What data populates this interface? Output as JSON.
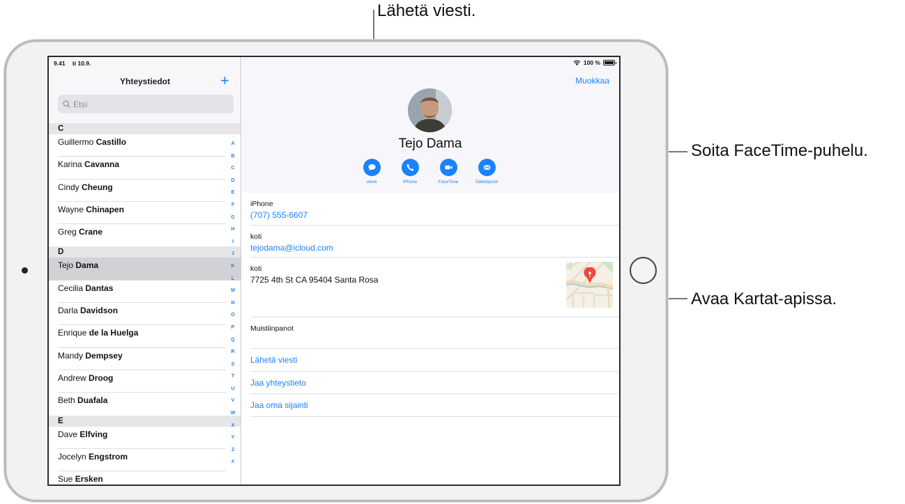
{
  "callouts": {
    "send_message": "Lähetä viesti.",
    "facetime": "Soita FaceTime-puhelu.",
    "maps": "Avaa Kartat-apissa."
  },
  "status_bar": {
    "time": "9.41",
    "date": "ti 10.9.",
    "battery": "100 %"
  },
  "list_pane": {
    "title": "Yhteystiedot",
    "add_label": "+",
    "search_placeholder": "Etsi",
    "sections": [
      {
        "letter": "C",
        "contacts": [
          {
            "first": "Guillermo",
            "last": "Castillo"
          },
          {
            "first": "Karina",
            "last": "Cavanna"
          },
          {
            "first": "Cindy",
            "last": "Cheung"
          },
          {
            "first": "Wayne",
            "last": "Chinapen"
          },
          {
            "first": "Greg",
            "last": "Crane"
          }
        ]
      },
      {
        "letter": "D",
        "contacts": [
          {
            "first": "Tejo",
            "last": "Dama",
            "selected": true
          },
          {
            "first": "Cecilia",
            "last": "Dantas"
          },
          {
            "first": "Darla",
            "last": "Davidson"
          },
          {
            "first": "Enrique",
            "last": "de la Huelga"
          },
          {
            "first": "Mandy",
            "last": "Dempsey"
          },
          {
            "first": "Andrew",
            "last": "Droog"
          },
          {
            "first": "Beth",
            "last": "Duafala"
          }
        ]
      },
      {
        "letter": "E",
        "contacts": [
          {
            "first": "Dave",
            "last": "Elfving"
          },
          {
            "first": "Jocelyn",
            "last": "Engstrom"
          },
          {
            "first": "Sue",
            "last": "Ersken"
          }
        ]
      }
    ],
    "index": [
      "A",
      "B",
      "C",
      "D",
      "E",
      "F",
      "G",
      "H",
      "I",
      "J",
      "K",
      "L",
      "M",
      "N",
      "O",
      "P",
      "Q",
      "R",
      "S",
      "T",
      "U",
      "V",
      "W",
      "X",
      "Y",
      "Z",
      "#"
    ]
  },
  "detail": {
    "edit_label": "Muokkaa",
    "name": "Tejo Dama",
    "actions": [
      {
        "label": "viesti",
        "icon": "message-icon"
      },
      {
        "label": "iPhone",
        "icon": "phone-icon"
      },
      {
        "label": "FaceTime",
        "icon": "video-icon"
      },
      {
        "label": "Sähköposti",
        "icon": "mail-icon"
      }
    ],
    "phone": {
      "label": "iPhone",
      "value": "(707) 555-6607"
    },
    "email": {
      "label": "koti",
      "value": "tejodama@icloud.com"
    },
    "address": {
      "label": "koti",
      "value": "7725 4th St CA 95404 Santa Rosa"
    },
    "notes": {
      "label": "Muistiinpanot",
      "value": ""
    },
    "links": [
      "Lähetä viesti",
      "Jaa yhteystieto",
      "Jaa oma sijainti"
    ]
  },
  "colors": {
    "accent": "#1a82fb",
    "selected_row": "#d2d2d6",
    "section_header": "#e6e6e9"
  }
}
